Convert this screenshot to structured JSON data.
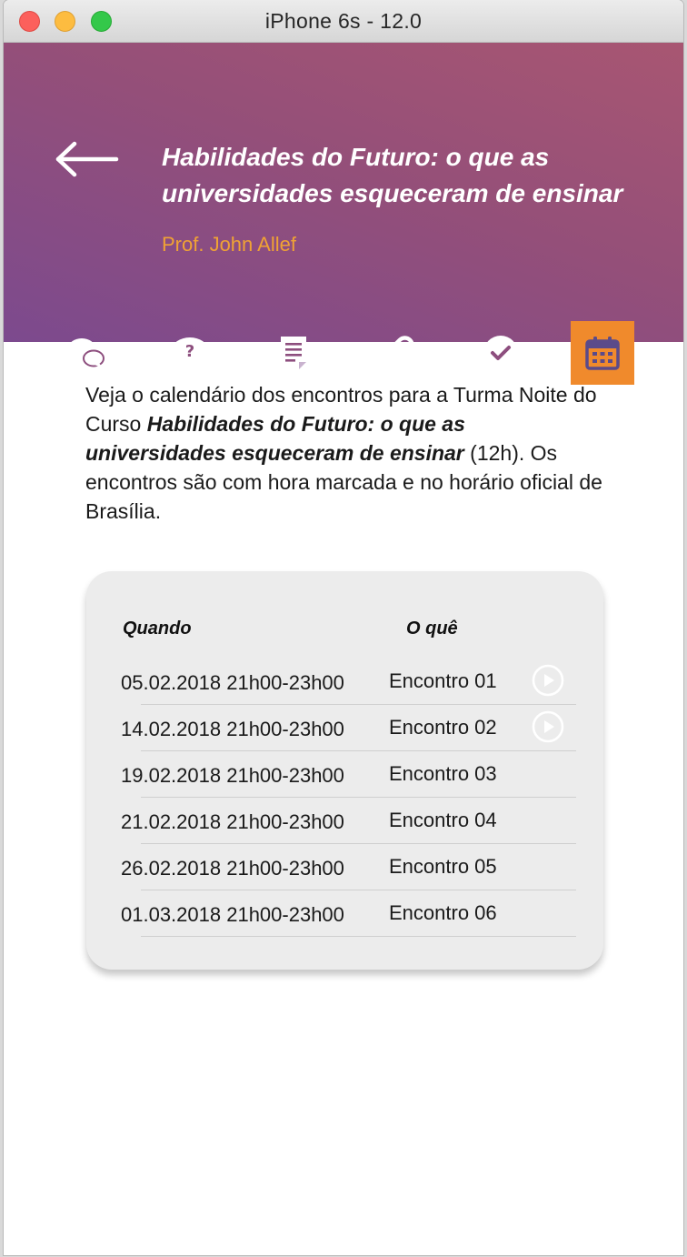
{
  "window": {
    "title": "iPhone 6s - 12.0"
  },
  "header": {
    "course_title": "Habilidades do Futuro: o que as universidades esqueceram de ensinar",
    "professor": "Prof. John Allef",
    "tabs": [
      {
        "icon": "chat-bubbles-icon",
        "active": false
      },
      {
        "icon": "question-bubble-icon",
        "active": false
      },
      {
        "icon": "document-icon",
        "active": false
      },
      {
        "icon": "link-icon",
        "active": false
      },
      {
        "icon": "checkmark-circle-icon",
        "active": false
      },
      {
        "icon": "calendar-icon",
        "active": true
      }
    ]
  },
  "intro": {
    "part1": "Veja o calendário dos encontros para a Turma Noite do Curso ",
    "bold": "Habilidades do Futuro: o que as universidades esqueceram de ensinar",
    "part2": " (12h). Os encontros são com hora marcada e no horário oficial de Brasília."
  },
  "schedule": {
    "col_when": "Quando",
    "col_what": "O quê",
    "rows": [
      {
        "when": "05.02.2018 21h00-23h00",
        "what": "Encontro 01",
        "has_play": true
      },
      {
        "when": "14.02.2018 21h00-23h00",
        "what": "Encontro 02",
        "has_play": true
      },
      {
        "when": "19.02.2018 21h00-23h00",
        "what": "Encontro 03",
        "has_play": false
      },
      {
        "when": "21.02.2018 21h00-23h00",
        "what": "Encontro 04",
        "has_play": false
      },
      {
        "when": "26.02.2018 21h00-23h00",
        "what": "Encontro 05",
        "has_play": false
      },
      {
        "when": "01.03.2018 21h00-23h00",
        "what": "Encontro 06",
        "has_play": false
      }
    ]
  },
  "colors": {
    "accent": "#f08a2c",
    "professor": "#f0a234",
    "header_top": "#a85672",
    "header_bottom": "#7c4a8e"
  }
}
